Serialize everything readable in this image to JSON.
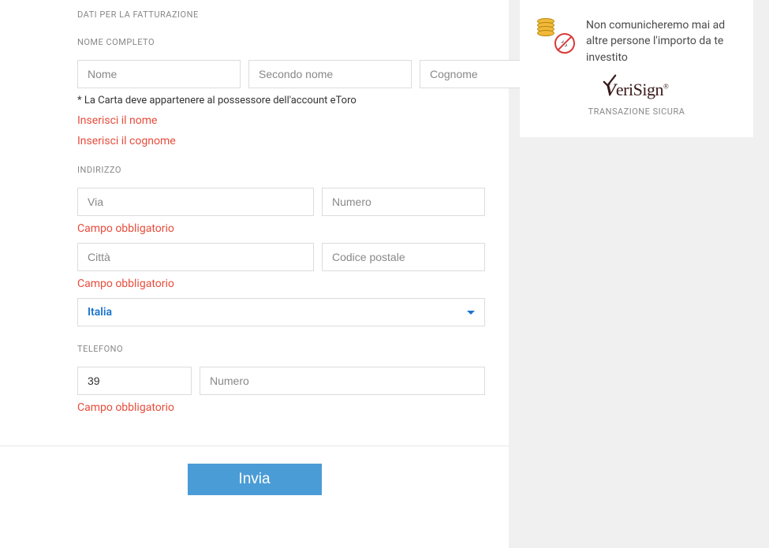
{
  "form": {
    "billing_header": "DATI PER LA FATTURAZIONE",
    "fullname_label": "NOME COMPLETO",
    "first_name_placeholder": "Nome",
    "middle_name_placeholder": "Secondo nome",
    "last_name_placeholder": "Cognome",
    "card_owner_note": "* La Carta deve appartenere al possessore dell'account eToro",
    "error_first_name": "Inserisci il nome",
    "error_last_name": "Inserisci il cognome",
    "address_label": "INDIRIZZO",
    "street_placeholder": "Via",
    "number_placeholder": "Numero",
    "error_required_1": "Campo obbligatorio",
    "city_placeholder": "Città",
    "postal_placeholder": "Codice postale",
    "error_required_2": "Campo obbligatorio",
    "country_value": "Italia",
    "phone_label": "TELEFONO",
    "phone_prefix_value": "39",
    "phone_number_placeholder": "Numero",
    "error_required_3": "Campo obbligatorio",
    "submit_label": "Invia"
  },
  "sidebar": {
    "privacy_text": "Non comunicheremo mai ad altre persone l'importo da te investito",
    "verisign_text": "VeriSign",
    "secure_label": "TRANSAZIONE SICURA"
  }
}
